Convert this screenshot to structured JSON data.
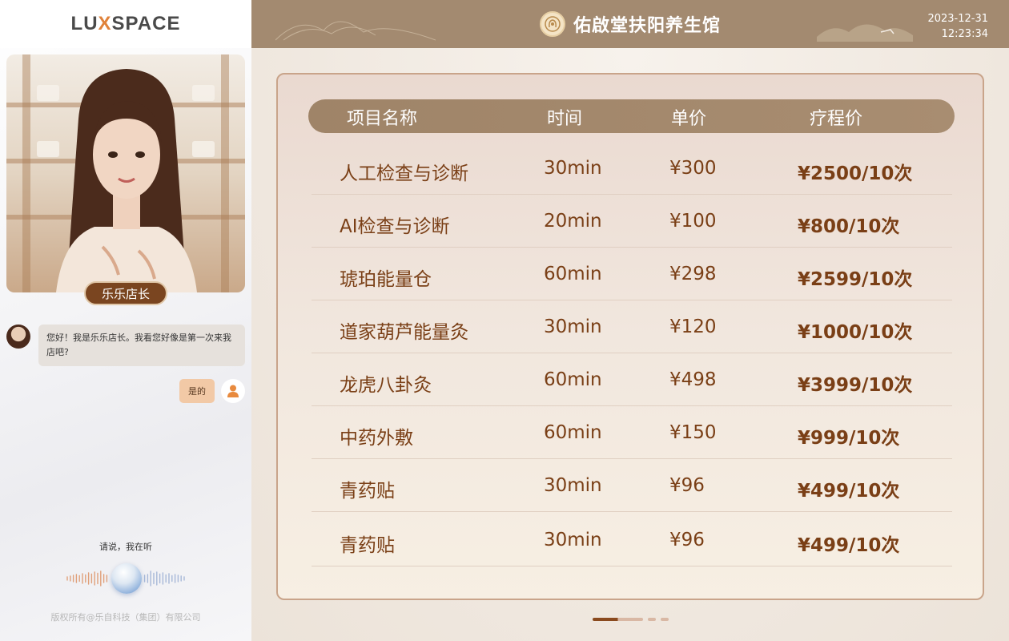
{
  "left": {
    "logo": {
      "pre": "LU",
      "mark": "X",
      "post": "SPACE"
    },
    "agent_name": "乐乐店长",
    "chat": {
      "bot_message": "您好！我是乐乐店长。我看您好像是第一次来我店吧?",
      "user_message": "是的"
    },
    "listen_text": "请说，我在听",
    "copyright": "版权所有@乐自科技（集团）有限公司"
  },
  "header": {
    "brand_name": "佑啟堂扶阳养生馆",
    "date": "2023-12-31",
    "time": "12:23:34"
  },
  "table": {
    "columns": [
      "项目名称",
      "时间",
      "单价",
      "疗程价"
    ],
    "rows": [
      {
        "name": "人工检查与诊断",
        "duration": "30min",
        "price": "¥300",
        "course_price": "¥2500/10次"
      },
      {
        "name": "AI检查与诊断",
        "duration": "20min",
        "price": "¥100",
        "course_price": "¥800/10次"
      },
      {
        "name": "琥珀能量仓",
        "duration": "60min",
        "price": "¥298",
        "course_price": "¥2599/10次"
      },
      {
        "name": "道家葫芦能量灸",
        "duration": "30min",
        "price": "¥120",
        "course_price": "¥1000/10次"
      },
      {
        "name": "龙虎八卦灸",
        "duration": "60min",
        "price": "¥498",
        "course_price": "¥3999/10次"
      },
      {
        "name": "中药外敷",
        "duration": "60min",
        "price": "¥150",
        "course_price": "¥999/10次"
      },
      {
        "name": "青药贴",
        "duration": "30min",
        "price": "¥96",
        "course_price": "¥499/10次"
      },
      {
        "name": "青药贴",
        "duration": "30min",
        "price": "¥96",
        "course_price": "¥499/10次"
      }
    ]
  },
  "pager": {
    "pages": 4,
    "current": 1
  },
  "colors": {
    "accent": "#a38a70",
    "text_brown": "#7a3f16",
    "logo_x": "#e0823a"
  }
}
